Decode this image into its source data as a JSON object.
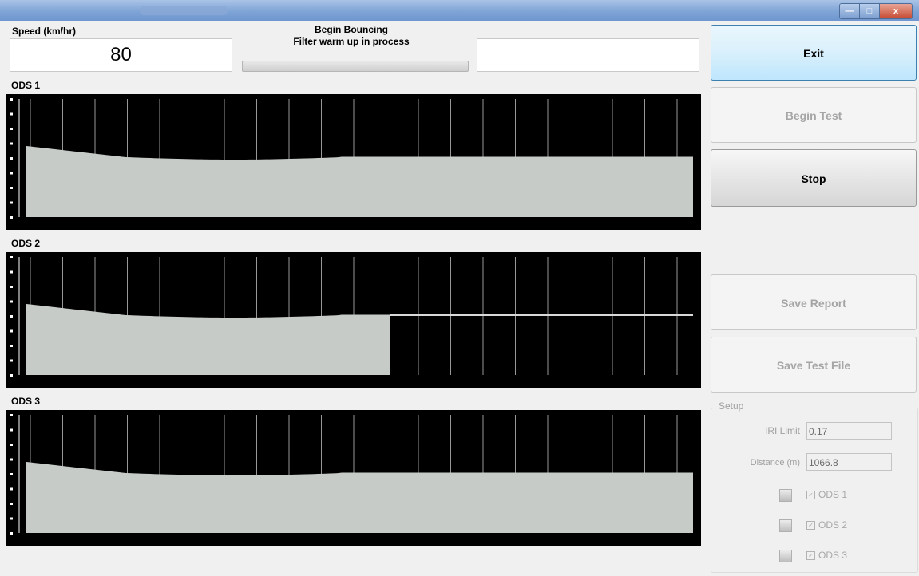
{
  "window": {
    "close_glyph": "x"
  },
  "speed": {
    "label": "Speed (km/hr)",
    "value": "80"
  },
  "status": {
    "line1": "Begin Bouncing",
    "line2": "Filter warm up in process"
  },
  "right_field": {
    "value": ""
  },
  "plots": [
    {
      "label": "ODS 1",
      "id": "p1",
      "fill_end_fraction": 1.0
    },
    {
      "label": "ODS 2",
      "id": "p2",
      "fill_end_fraction": 0.545
    },
    {
      "label": "ODS 3",
      "id": "p3",
      "fill_end_fraction": 1.0
    }
  ],
  "buttons": {
    "exit": "Exit",
    "begin_test": "Begin Test",
    "stop": "Stop",
    "save_report": "Save Report",
    "save_test_file": "Save Test File"
  },
  "setup": {
    "title": "Setup",
    "iri_label": "IRI Limit",
    "iri_value": "0.17",
    "distance_label": "Distance (m)",
    "distance_value": "1066.8",
    "ods_checks": [
      {
        "label": "ODS 1",
        "checked": true
      },
      {
        "label": "ODS 2",
        "checked": true
      },
      {
        "label": "ODS 3",
        "checked": true
      }
    ]
  },
  "colors": {
    "plot_bg": "#000000",
    "plot_fill": "#c6cbc7",
    "grid": "#ffffff",
    "exit_accent": "#3c7fb1"
  }
}
